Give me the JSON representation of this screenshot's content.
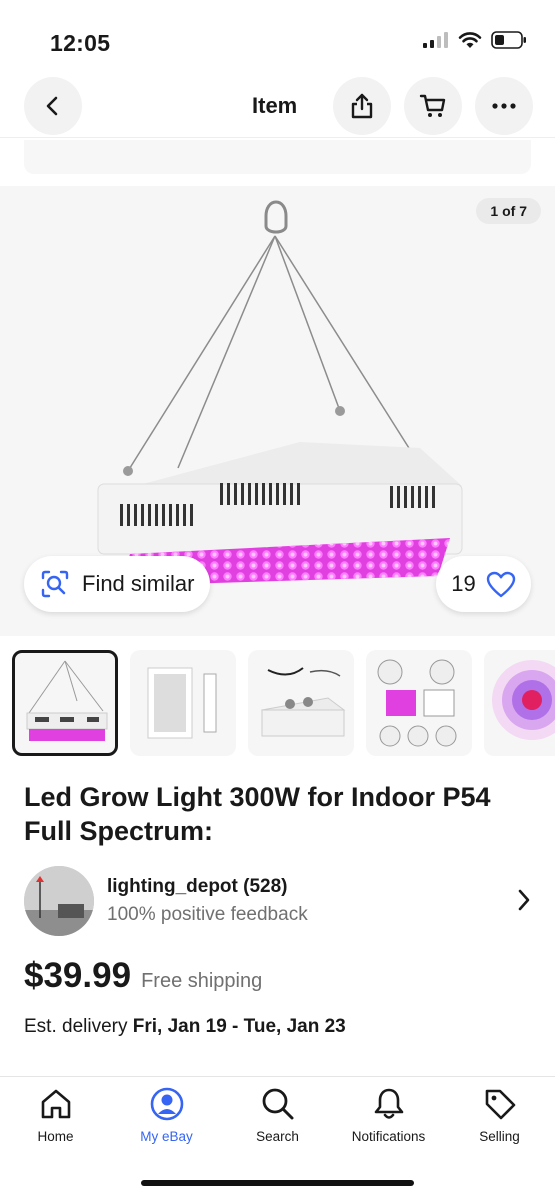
{
  "status_bar": {
    "time": "12:05"
  },
  "nav": {
    "title": "Item"
  },
  "gallery": {
    "counter": "1 of 7",
    "find_similar_label": "Find similar",
    "watch_count": "19"
  },
  "item": {
    "title": "Led Grow Light 300W for Indoor P54 Full Spectrum:",
    "price": "$39.99",
    "shipping": "Free shipping",
    "delivery_prefix": "Est. delivery ",
    "delivery_dates": "Fri, Jan 19 - Tue, Jan 23"
  },
  "seller": {
    "name": "lighting_depot (528)",
    "feedback": "100% positive feedback"
  },
  "tabs": [
    {
      "label": "Home",
      "icon": "home-icon"
    },
    {
      "label": "My eBay",
      "icon": "user-icon",
      "active": true
    },
    {
      "label": "Search",
      "icon": "search-icon"
    },
    {
      "label": "Notifications",
      "icon": "bell-icon"
    },
    {
      "label": "Selling",
      "icon": "tag-icon"
    }
  ],
  "colors": {
    "accent": "#3665f3",
    "text": "#191919",
    "muted": "#707070",
    "led": "#e040e0"
  }
}
